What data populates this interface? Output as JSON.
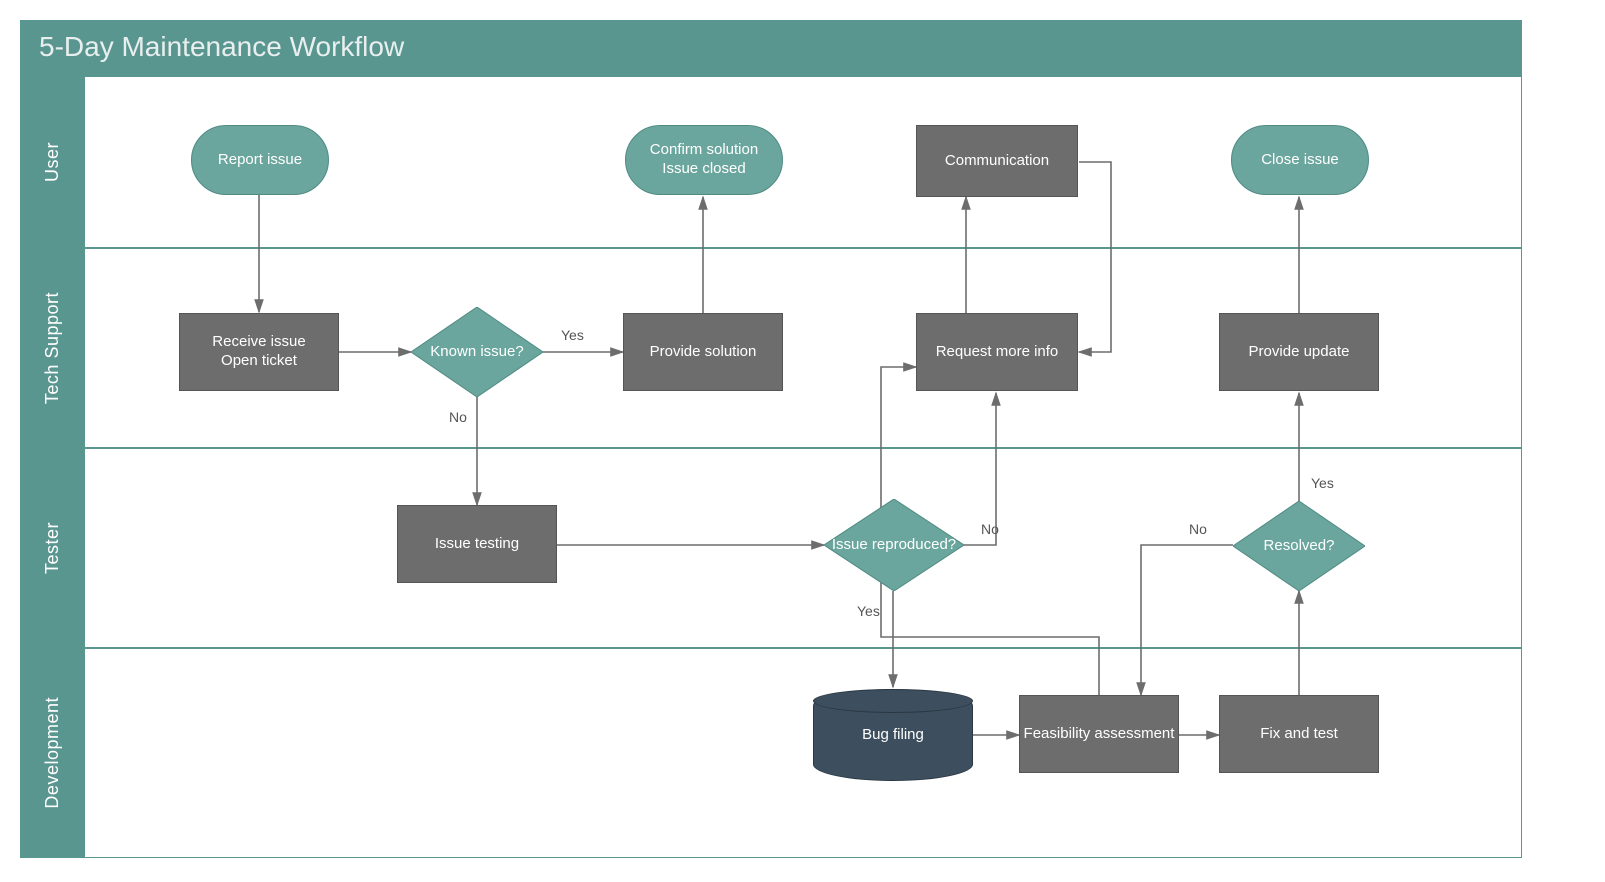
{
  "title": "5-Day Maintenance Workflow",
  "lanes": {
    "user": "User",
    "tech": "Tech Support",
    "tester": "Tester",
    "dev": "Development"
  },
  "nodes": {
    "report": "Report issue",
    "confirm": "Confirm solution\nIssue closed",
    "communication": "Communication",
    "close": "Close issue",
    "receive": "Receive issue\nOpen ticket",
    "known": "Known issue?",
    "provide_solution": "Provide solution",
    "request_info": "Request more info",
    "provide_update": "Provide update",
    "issue_testing": "Issue testing",
    "reproduced": "Issue reproduced?",
    "resolved": "Resolved?",
    "bug_filing": "Bug filing",
    "feasibility": "Feasibility assessment",
    "fix_test": "Fix and test"
  },
  "edges": {
    "yes1": "Yes",
    "no1": "No",
    "yes2": "Yes",
    "no2": "No",
    "yes3": "Yes",
    "no3": "No"
  },
  "chart_data": {
    "type": "swimlane-flowchart",
    "title": "5-Day Maintenance Workflow",
    "lanes": [
      "User",
      "Tech Support",
      "Tester",
      "Development"
    ],
    "nodes": [
      {
        "id": "report",
        "lane": "User",
        "shape": "terminator",
        "label": "Report issue"
      },
      {
        "id": "confirm",
        "lane": "User",
        "shape": "terminator",
        "label": "Confirm solution / Issue closed"
      },
      {
        "id": "communication",
        "lane": "User",
        "shape": "process",
        "label": "Communication"
      },
      {
        "id": "close",
        "lane": "User",
        "shape": "terminator",
        "label": "Close issue"
      },
      {
        "id": "receive",
        "lane": "Tech Support",
        "shape": "process",
        "label": "Receive issue / Open ticket"
      },
      {
        "id": "known",
        "lane": "Tech Support",
        "shape": "decision",
        "label": "Known issue?"
      },
      {
        "id": "provide_solution",
        "lane": "Tech Support",
        "shape": "process",
        "label": "Provide solution"
      },
      {
        "id": "request_info",
        "lane": "Tech Support",
        "shape": "process",
        "label": "Request more info"
      },
      {
        "id": "provide_update",
        "lane": "Tech Support",
        "shape": "process",
        "label": "Provide update"
      },
      {
        "id": "issue_testing",
        "lane": "Tester",
        "shape": "process",
        "label": "Issue testing"
      },
      {
        "id": "reproduced",
        "lane": "Tester",
        "shape": "decision",
        "label": "Issue reproduced?"
      },
      {
        "id": "resolved",
        "lane": "Tester",
        "shape": "decision",
        "label": "Resolved?"
      },
      {
        "id": "bug_filing",
        "lane": "Development",
        "shape": "datastore",
        "label": "Bug filing"
      },
      {
        "id": "feasibility",
        "lane": "Development",
        "shape": "process",
        "label": "Feasibility assessment"
      },
      {
        "id": "fix_test",
        "lane": "Development",
        "shape": "process",
        "label": "Fix and test"
      }
    ],
    "edges": [
      {
        "from": "report",
        "to": "receive"
      },
      {
        "from": "receive",
        "to": "known"
      },
      {
        "from": "known",
        "to": "provide_solution",
        "label": "Yes"
      },
      {
        "from": "known",
        "to": "issue_testing",
        "label": "No"
      },
      {
        "from": "provide_solution",
        "to": "confirm"
      },
      {
        "from": "issue_testing",
        "to": "reproduced"
      },
      {
        "from": "reproduced",
        "to": "request_info",
        "label": "No"
      },
      {
        "from": "reproduced",
        "to": "bug_filing",
        "label": "Yes"
      },
      {
        "from": "request_info",
        "to": "communication"
      },
      {
        "from": "communication",
        "to": "request_info"
      },
      {
        "from": "bug_filing",
        "to": "feasibility"
      },
      {
        "from": "feasibility",
        "to": "fix_test"
      },
      {
        "from": "feasibility",
        "to": "request_info"
      },
      {
        "from": "fix_test",
        "to": "resolved"
      },
      {
        "from": "resolved",
        "to": "provide_update",
        "label": "Yes"
      },
      {
        "from": "resolved",
        "to": "feasibility",
        "label": "No"
      },
      {
        "from": "provide_update",
        "to": "close"
      }
    ]
  }
}
